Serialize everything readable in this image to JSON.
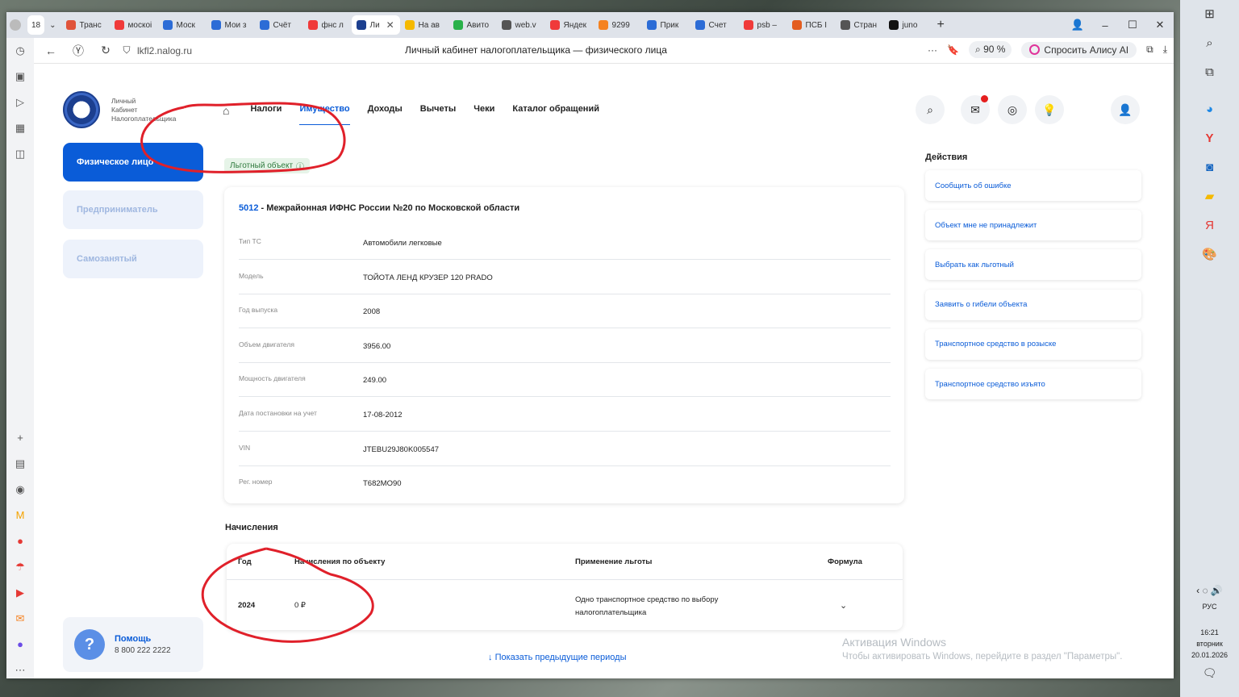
{
  "browser": {
    "tab_count": "18",
    "tabs": [
      {
        "label": "Транс",
        "color": "#e0533a"
      },
      {
        "label": "москоі",
        "color": "#f03a3a"
      },
      {
        "label": "Моск",
        "color": "#2c6cd6"
      },
      {
        "label": "Мои з",
        "color": "#2c6cd6"
      },
      {
        "label": "Счёт",
        "color": "#2c6cd6"
      },
      {
        "label": "фнс л",
        "color": "#f03a3a"
      },
      {
        "label": "Ли",
        "color": "#1c3f8f"
      },
      {
        "label": "На ав",
        "color": "#f5b900"
      },
      {
        "label": "Авито",
        "color": "#29b14a"
      },
      {
        "label": "web.v",
        "color": "#555555"
      },
      {
        "label": "Яндек",
        "color": "#f03a3a"
      },
      {
        "label": "9299",
        "color": "#f58220"
      },
      {
        "label": "Прик",
        "color": "#2c6cd6"
      },
      {
        "label": "Счет",
        "color": "#2c6cd6"
      },
      {
        "label": "psb –",
        "color": "#f03a3a"
      },
      {
        "label": "ПСБ I",
        "color": "#e35d1f"
      },
      {
        "label": "Стран",
        "color": "#555555"
      },
      {
        "label": "juno",
        "color": "#111111"
      }
    ],
    "url": "lkfl2.nalog.ru",
    "page_title": "Личный кабинет налогоплательщика — физического лица",
    "zoom": "90 %",
    "alice": "Спросить Алису AI"
  },
  "site": {
    "logo_text": [
      "Личный",
      "Кабинет",
      "Налогоплательщика"
    ],
    "nav": [
      "Налоги",
      "Имущество",
      "Доходы",
      "Вычеты",
      "Чеки",
      "Каталог обращений"
    ],
    "sidebar": [
      "Физическое лицо",
      "Предприниматель",
      "Самозанятый"
    ],
    "help_title": "Помощь",
    "help_phone": "8 800 222 2222"
  },
  "object": {
    "badge": "Льготный объект",
    "inspection_code": "5012",
    "inspection_name": " - Межрайонная ИФНС России №20 по Московской области",
    "fields": [
      {
        "label": "Тип ТС",
        "value": "Автомобили легковые"
      },
      {
        "label": "Модель",
        "value": "ТОЙОТА ЛЕНД КРУЗЕР 120 PRADO"
      },
      {
        "label": "Год выпуска",
        "value": "2008"
      },
      {
        "label": "Объем двигателя",
        "value": "3956.00"
      },
      {
        "label": "Мощность двигателя",
        "value": "249.00"
      },
      {
        "label": "Дата постановки на учет",
        "value": "17-08-2012"
      },
      {
        "label": "VIN",
        "value": "JTEBU29J80K005547"
      },
      {
        "label": "Рег. номер",
        "value": "Т682МО90"
      }
    ]
  },
  "accruals": {
    "title": "Начисления",
    "headers": [
      "Год",
      "Начисления по объекту",
      "Применение льготы",
      "Формула"
    ],
    "rows": [
      {
        "year": "2024",
        "amount": "0 ₽",
        "benefit": "Одно транспортное средство по выбору налогоплательщика"
      }
    ],
    "more": "Показать предыдущие периоды"
  },
  "actions": {
    "title": "Действия",
    "items": [
      "Сообщить об ошибке",
      "Объект мне не принадлежит",
      "Выбрать как льготный",
      "Заявить о гибели объекта",
      "Транспортное средство в розыске",
      "Транспортное средство изъято"
    ]
  },
  "watermark": {
    "line1": "Активация Windows",
    "line2": "Чтобы активировать Windows, перейдите в раздел \"Параметры\"."
  },
  "system": {
    "lang": "РУС",
    "time": "16:21",
    "day": "вторник",
    "date": "20.01.2026"
  }
}
